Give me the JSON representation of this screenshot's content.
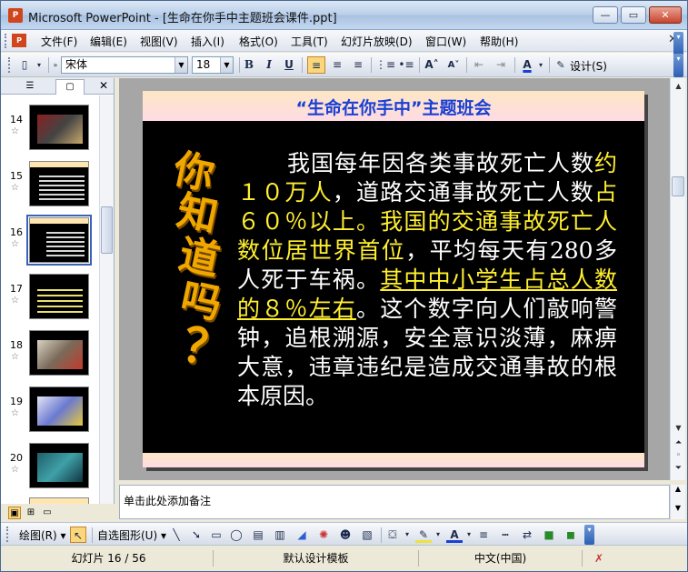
{
  "window": {
    "app_icon": "powerpoint-icon",
    "title": "Microsoft PowerPoint - [生命在你手中主题班会课件.ppt]",
    "minimize": "—",
    "restore": "▭",
    "close": "✕"
  },
  "menu": {
    "doc_icon_text": "P",
    "items": [
      "文件(F)",
      "编辑(E)",
      "视图(V)",
      "插入(I)",
      "格式(O)",
      "工具(T)",
      "幻灯片放映(D)",
      "窗口(W)",
      "帮助(H)"
    ],
    "close_doc": "✕"
  },
  "toolbar": {
    "font_name": "宋体",
    "font_size": "18",
    "bold": "B",
    "italic": "I",
    "underline": "U",
    "grow_font": "A˄",
    "shrink_font": "A˅",
    "font_color": "A",
    "design_label": "设计(S)"
  },
  "left_pane": {
    "tab_outline": "☰",
    "tab_slides": "▢",
    "close": "✕",
    "star": "☆",
    "thumbnails": [
      {
        "number": "14"
      },
      {
        "number": "15"
      },
      {
        "number": "16"
      },
      {
        "number": "17"
      },
      {
        "number": "18"
      },
      {
        "number": "19"
      },
      {
        "number": "20"
      }
    ],
    "selected": "16"
  },
  "slide": {
    "title": "“生命在你手中”主题班会",
    "wordart": [
      "你",
      "知",
      "道",
      "吗",
      "？"
    ],
    "body": {
      "p1": "我国每年因各类事故死亡人数",
      "p2": "约１０万人",
      "p3": "，道路交通事故死亡人数",
      "p4": "占６０％以上。我国的交通事故死亡人数位居世界首位",
      "p5": "，平均每天有280多人死于车祸。",
      "p6": "其中中小学生占总人数的８％左右",
      "p7": "。这个数字向人们敲响警钟，追根溯源，安全意识淡薄，麻痹大意，违章违纪是造成交通事故的根本原因。"
    },
    "colors": {
      "title": "#1a3fd4",
      "highlight": "#ffef30",
      "body": "#ffffff",
      "background": "#000000"
    }
  },
  "notes": {
    "placeholder": "单击此处添加备注"
  },
  "draw_toolbar": {
    "draw_menu": "绘图(R) ▾",
    "autoshapes_menu": "自选图形(U) ▾"
  },
  "status": {
    "slide_position": "幻灯片 16 / 56",
    "design_template": "默认设计模板",
    "language": "中文(中国)"
  }
}
